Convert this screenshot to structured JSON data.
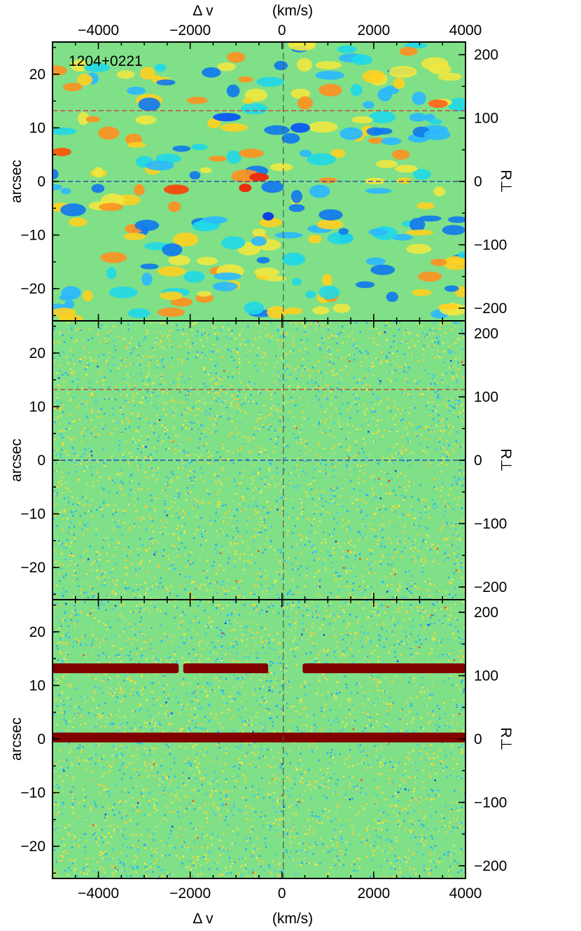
{
  "chart_data": {
    "type": "heatmap",
    "top_axis_label": {
      "delta": "Δ v",
      "unit": "(km/s)"
    },
    "bottom_axis_label": {
      "delta": "Δ v",
      "unit": "(km/s)"
    },
    "ylabel": "arcsec",
    "right_label": "R⊥",
    "x_range": [
      -5000,
      4000
    ],
    "x_ticks": [
      -4000,
      -2000,
      0,
      2000,
      4000
    ],
    "x_tick_labels": [
      "−4000",
      "−2000",
      "0",
      "2000",
      "4000"
    ],
    "y_range": [
      -26,
      26
    ],
    "y_ticks": [
      -20,
      -10,
      0,
      10,
      20
    ],
    "y_tick_labels": [
      "−20",
      "−10",
      "0",
      "10",
      "20"
    ],
    "right_range": [
      -220,
      220
    ],
    "right_ticks": [
      -200,
      -100,
      0,
      100,
      200
    ],
    "right_tick_labels": [
      "−200",
      "−100",
      "0",
      "100",
      "200"
    ],
    "colors": {
      "background": "#7fe088",
      "red_line": "#d03030",
      "blue_line": "#2030c0",
      "band": "#800000",
      "vline": "#555555"
    },
    "panels": [
      {
        "name": "smoothed",
        "annotation": "1204+0221",
        "style": "smooth",
        "hlines": [
          {
            "y": 13.2,
            "color": "red"
          },
          {
            "y": 0,
            "color": "blue"
          }
        ],
        "bands": []
      },
      {
        "name": "noise",
        "annotation": "",
        "style": "noise",
        "hlines": [
          {
            "y": 13.2,
            "color": "red"
          },
          {
            "y": 0,
            "color": "blue"
          }
        ],
        "bands": []
      },
      {
        "name": "continuum",
        "annotation": "",
        "style": "noise",
        "hlines": [],
        "bands": [
          {
            "y": 13.2,
            "x_segments": [
              [
                -5000,
                -2250
              ],
              [
                -2150,
                -300
              ],
              [
                450,
                4000
              ]
            ]
          },
          {
            "y": 0.3,
            "x_segments": [
              [
                -5000,
                4000
              ]
            ]
          }
        ]
      }
    ]
  }
}
